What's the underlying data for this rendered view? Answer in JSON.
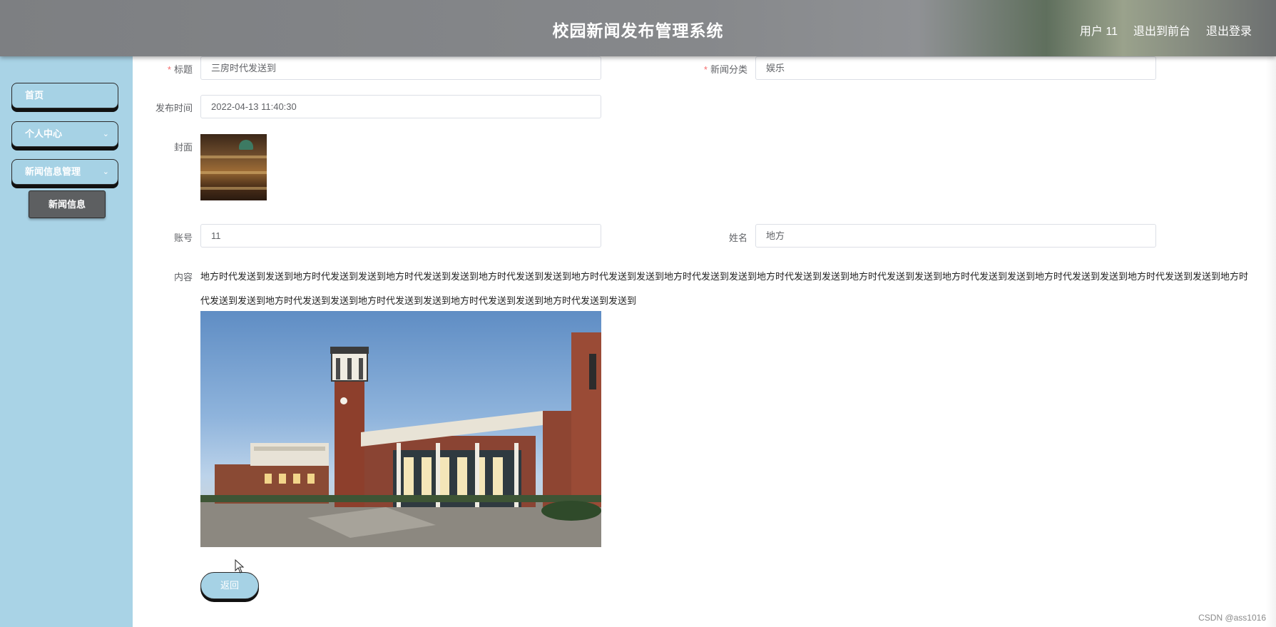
{
  "header": {
    "title": "校园新闻发布管理系统",
    "user": "用户 11",
    "to_front": "退出到前台",
    "logout": "退出登录"
  },
  "sidebar": {
    "items": [
      {
        "label": "首页"
      },
      {
        "label": "个人中心"
      },
      {
        "label": "新闻信息管理"
      }
    ],
    "subitem": "新闻信息"
  },
  "form": {
    "title_label": "标题",
    "title_value": "三房时代发送到",
    "category_label": "新闻分类",
    "category_value": "娱乐",
    "publish_time_label": "发布时间",
    "publish_time_value": "2022-04-13 11:40:30",
    "cover_label": "封面",
    "account_label": "账号",
    "account_value": "11",
    "name_label": "姓名",
    "name_value": "地方",
    "content_label": "内容",
    "content_text": "地方时代发送到发送到地方时代发送到发送到地方时代发送到发送到地方时代发送到发送到地方时代发送到发送到地方时代发送到发送到地方时代发送到发送到地方时代发送到发送到地方时代发送到发送到地方时代发送到发送到地方时代发送到发送到地方时代发送到发送到地方时代发送到发送到地方时代发送到发送到地方时代发送到发送到地方时代发送到发送到",
    "back_label": "返回"
  },
  "watermark": "CSDN @ass1016"
}
